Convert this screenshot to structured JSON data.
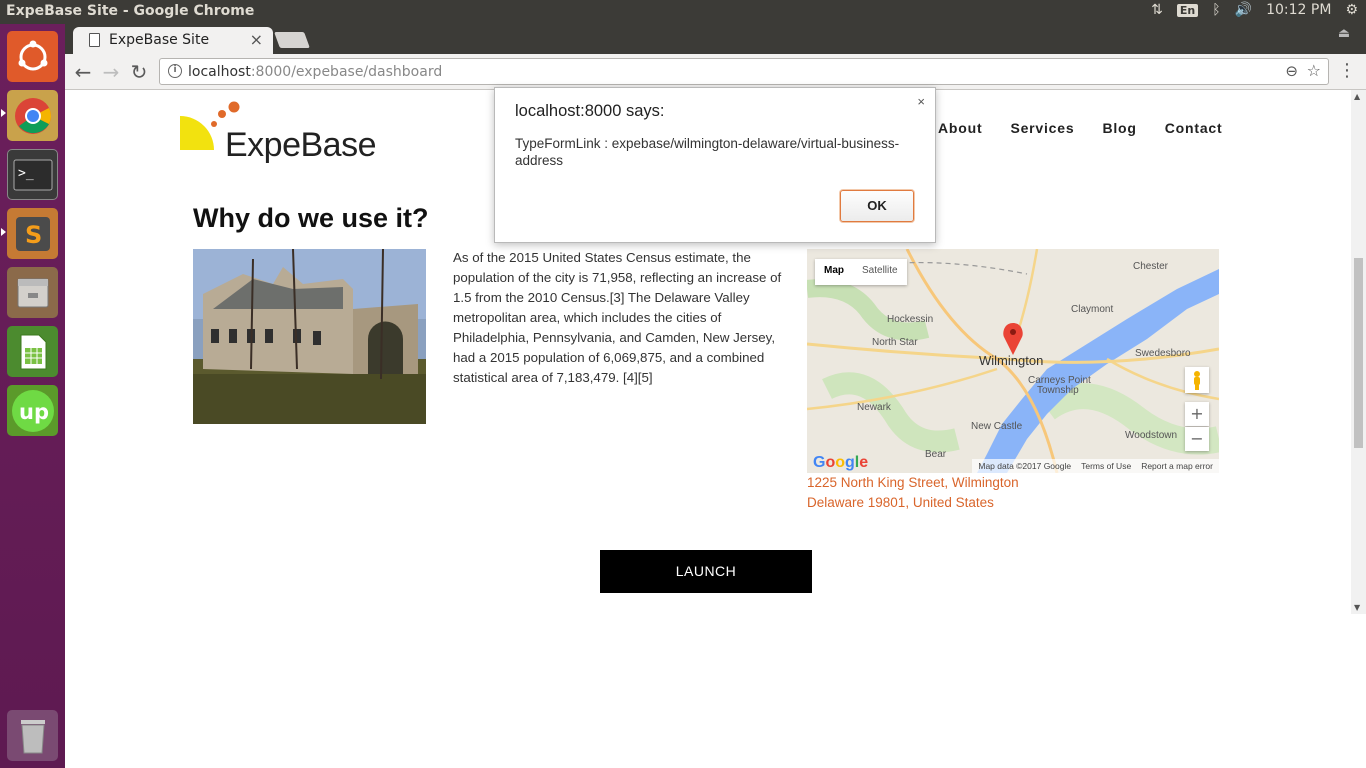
{
  "os": {
    "window_title": "ExpeBase Site - Google Chrome",
    "language": "En",
    "clock": "10:12 PM"
  },
  "browser": {
    "tab_title": "ExpeBase Site",
    "tab_close": "×",
    "url_host": "localhost",
    "url_rest": ":8000/expebase/dashboard"
  },
  "site": {
    "logo_text": "ExpeBase",
    "nav": [
      "About",
      "Services",
      "Blog",
      "Contact"
    ],
    "section_title": "Why do we use it?",
    "body_text": "As of the 2015 United States Census estimate, the population of the city is 71,958, reflecting an increase of 1.5 from the 2010 Census.[3] The Delaware Valley metropolitan area, which includes the cities of Philadelphia, Pennsylvania, and Camden, New Jersey, had a 2015 population of 6,069,875, and a combined statistical area of 7,183,479. [4][5]",
    "map": {
      "tab_map": "Map",
      "tab_satellite": "Satellite",
      "zoom_in": "+",
      "zoom_out": "−",
      "google": "Google",
      "map_data": "Map data ©2017 Google",
      "terms": "Terms of Use",
      "report": "Report a map error",
      "labels": {
        "wilmington": "Wilmington",
        "chester": "Chester",
        "claymont": "Claymont",
        "hockessin": "Hockessin",
        "north_star": "North Star",
        "swedesboro": "Swedesboro",
        "carneys": "Carneys Point",
        "township": "Township",
        "newark": "Newark",
        "new_castle": "New Castle",
        "woodstown": "Woodstown",
        "bear": "Bear"
      }
    },
    "address_line1": "1225 North King Street, Wilmington",
    "address_line2": "Delaware 19801, United States",
    "launch_label": "LAUNCH"
  },
  "alert": {
    "title": "localhost:8000 says:",
    "message": "TypeFormLink : expebase/wilmington-delaware/virtual-business-address",
    "ok_label": "OK",
    "close": "×"
  },
  "colors": {
    "accent_orange": "#d9652b",
    "logo_yellow": "#f2e20f",
    "launcher_purple": "#6b1f5c"
  }
}
